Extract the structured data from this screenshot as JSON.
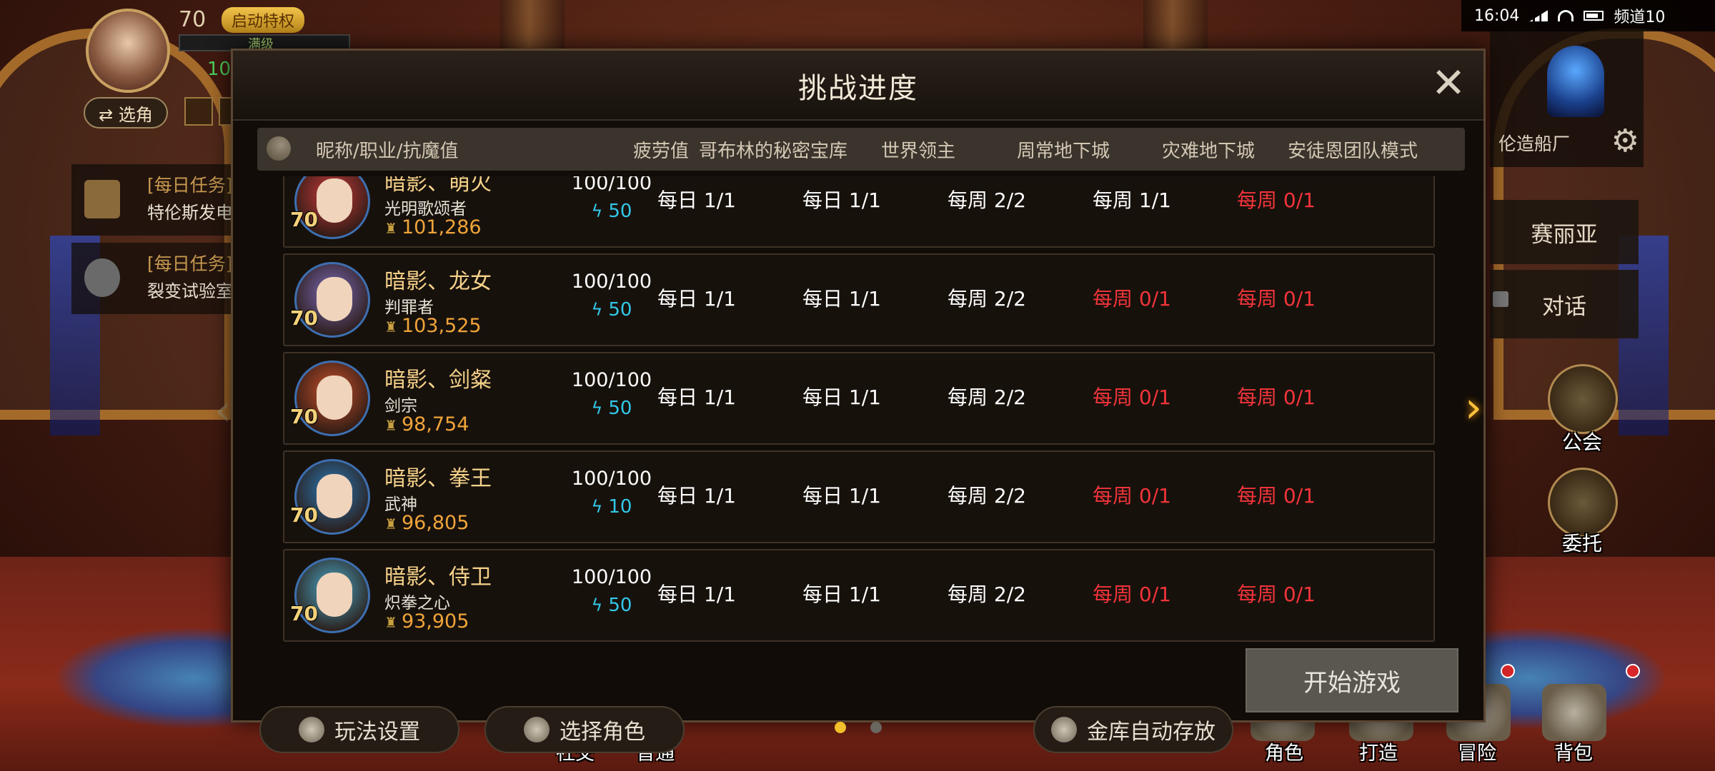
{
  "hud": {
    "level": "70",
    "privilege_badge": "启动特权",
    "exp_text": "满级",
    "currency_value": "10",
    "switch_button": "⇄ 选角"
  },
  "status_bar": {
    "time": "16:04",
    "channel": "频道10"
  },
  "tasks": [
    {
      "title": "[每日任务]",
      "desc": "特伦斯发电"
    },
    {
      "title": "[每日任务]",
      "desc": "裂变试验室"
    }
  ],
  "right_panel": {
    "location": "伦造船厂",
    "npc_name": "赛丽亚",
    "talk_label": "对话",
    "menu": [
      "公会",
      "委托"
    ]
  },
  "bottom_bar": [
    "社交",
    "普通",
    "角色",
    "打造",
    "冒险",
    "背包"
  ],
  "modal": {
    "title": "挑战进度",
    "close": "✕",
    "headers": [
      "昵称/职业/抗魔值",
      "疲劳值",
      "哥布林的秘密宝库",
      "世界领主",
      "周常地下城",
      "灾难地下城",
      "安徒恩团队模式"
    ],
    "rows": [
      {
        "name": "暗影、萌火",
        "job": "光明歌颂者",
        "power": "101,286",
        "level": "70",
        "fatigue": "100/100",
        "energy": "50",
        "cells": [
          "每日 1/1",
          "每日 1/1",
          "每周 2/2",
          "每周 1/1",
          "每周 0/1"
        ],
        "red": [
          false,
          false,
          false,
          false,
          true
        ],
        "portrait_color": "#c83a3a"
      },
      {
        "name": "暗影、龙女",
        "job": "判罪者",
        "power": "103,525",
        "level": "70",
        "fatigue": "100/100",
        "energy": "50",
        "cells": [
          "每日 1/1",
          "每日 1/1",
          "每周 2/2",
          "每周 0/1",
          "每周 0/1"
        ],
        "red": [
          false,
          false,
          false,
          true,
          true
        ],
        "portrait_color": "#7a6ab8"
      },
      {
        "name": "暗影、剑粲",
        "job": "剑宗",
        "power": "98,754",
        "level": "70",
        "fatigue": "100/100",
        "energy": "50",
        "cells": [
          "每日 1/1",
          "每日 1/1",
          "每周 2/2",
          "每周 0/1",
          "每周 0/1"
        ],
        "red": [
          false,
          false,
          false,
          true,
          true
        ],
        "portrait_color": "#c8502a"
      },
      {
        "name": "暗影、拳王",
        "job": "武神",
        "power": "96,805",
        "level": "70",
        "fatigue": "100/100",
        "energy": "10",
        "cells": [
          "每日 1/1",
          "每日 1/1",
          "每周 2/2",
          "每周 0/1",
          "每周 0/1"
        ],
        "red": [
          false,
          false,
          false,
          true,
          true
        ],
        "portrait_color": "#2a7ab8"
      },
      {
        "name": "暗影、侍卫",
        "job": "炽拳之心",
        "power": "93,905",
        "level": "70",
        "fatigue": "100/100",
        "energy": "50",
        "cells": [
          "每日 1/1",
          "每日 1/1",
          "每周 2/2",
          "每周 0/1",
          "每周 0/1"
        ],
        "red": [
          false,
          false,
          false,
          true,
          true
        ],
        "portrait_color": "#4aa8c8"
      }
    ],
    "buttons": {
      "settings": "玩法设置",
      "select_role": "选择角色",
      "auto_store": "金库自动存放",
      "start": "开始游戏"
    },
    "page_indicator": {
      "current": 1,
      "total": 2
    }
  },
  "colors": {
    "accent_gold": "#f6d28a",
    "warn_red": "#f2343a",
    "energy_cyan": "#32c8e8"
  }
}
